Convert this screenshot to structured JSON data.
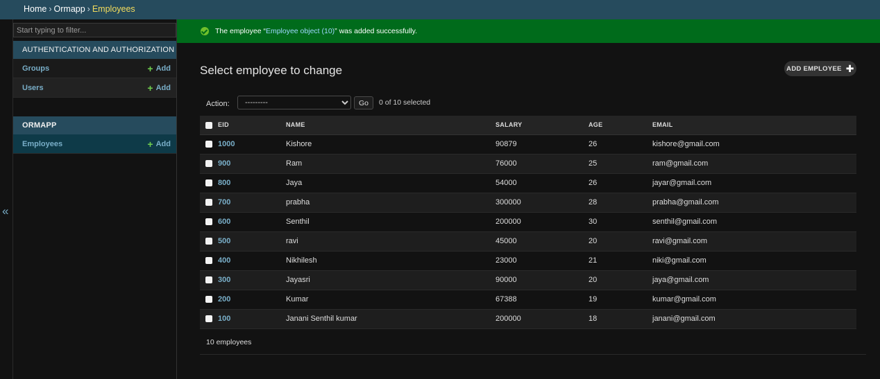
{
  "breadcrumbs": {
    "home": "Home",
    "app": "Ormapp",
    "current": "Employees",
    "separator": "›"
  },
  "sidebar": {
    "filter_placeholder": "Start typing to filter...",
    "collapse_glyph": "«",
    "apps": [
      {
        "caption": "AUTHENTICATION AND AUTHORIZATION",
        "models": [
          {
            "name": "Groups",
            "add": "Add"
          },
          {
            "name": "Users",
            "add": "Add"
          }
        ]
      },
      {
        "caption": "ORMAPP",
        "models": [
          {
            "name": "Employees",
            "add": "Add"
          }
        ]
      }
    ]
  },
  "message": {
    "prefix": "The employee “",
    "link": "Employee object (10)",
    "suffix": "” was added successfully."
  },
  "page": {
    "title": "Select employee to change",
    "add_button": "ADD EMPLOYEE"
  },
  "actions": {
    "label": "Action:",
    "selected_option": "---------",
    "go": "Go",
    "counter": "0 of 10 selected"
  },
  "table": {
    "headers": [
      "EID",
      "NAME",
      "SALARY",
      "AGE",
      "EMAIL"
    ],
    "rows": [
      [
        "1000",
        "Kishore",
        "90879",
        "26",
        "kishore@gmail.com"
      ],
      [
        "900",
        "Ram",
        "76000",
        "25",
        "ram@gmail.com"
      ],
      [
        "800",
        "Jaya",
        "54000",
        "26",
        "jayar@gmail.com"
      ],
      [
        "700",
        "prabha",
        "300000",
        "28",
        "prabha@gmail.com"
      ],
      [
        "600",
        "Senthil",
        "200000",
        "30",
        "senthil@gmail.com"
      ],
      [
        "500",
        "ravi",
        "45000",
        "20",
        "ravi@gmail.com"
      ],
      [
        "400",
        "Nikhilesh",
        "23000",
        "21",
        "niki@gmail.com"
      ],
      [
        "300",
        "Jayasri",
        "90000",
        "20",
        "jaya@gmail.com"
      ],
      [
        "200",
        "Kumar",
        "67388",
        "19",
        "kumar@gmail.com"
      ],
      [
        "100",
        "Janani Senthil kumar",
        "200000",
        "18",
        "janani@gmail.com"
      ]
    ]
  },
  "paginator": "10 employees",
  "colors": {
    "header": "#264b5d",
    "success": "#006b1b",
    "link": "#79aec8",
    "add_green": "#6fce4e"
  }
}
